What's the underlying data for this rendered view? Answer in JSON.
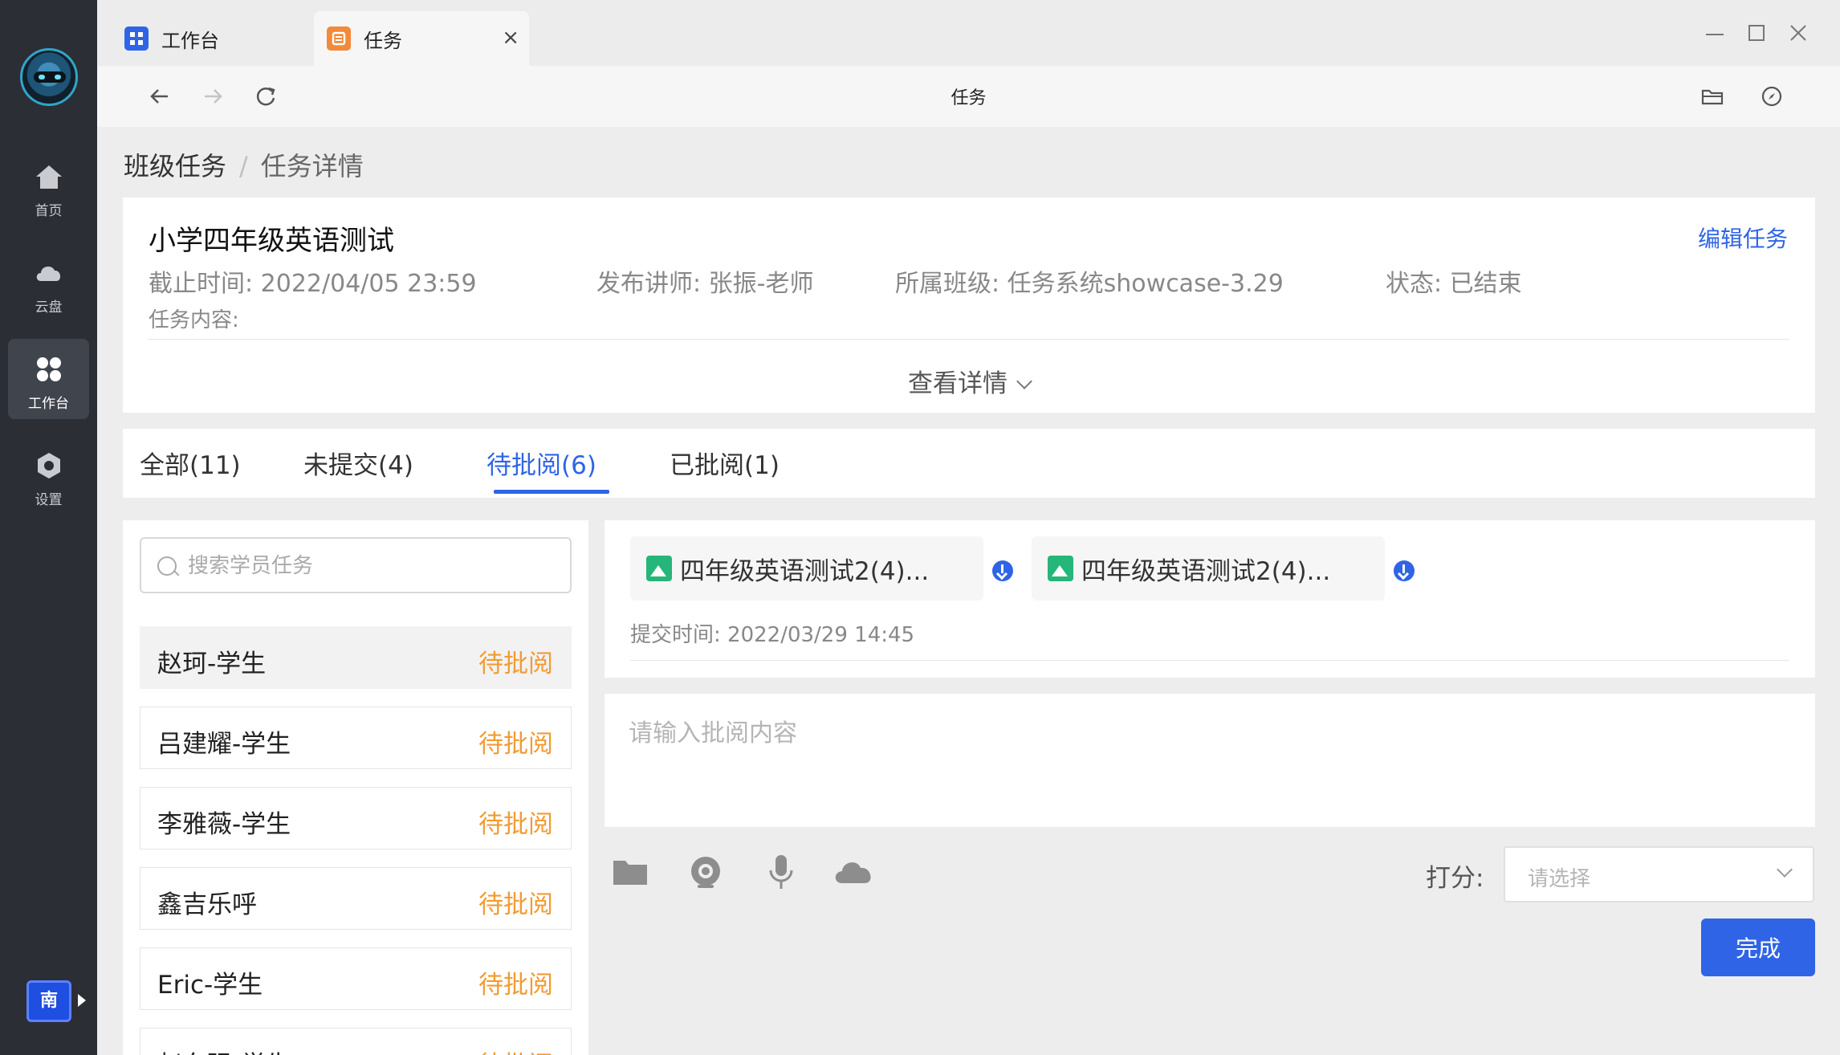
{
  "sidebar": {
    "items": [
      {
        "label": "首页",
        "icon": "home-icon"
      },
      {
        "label": "云盘",
        "icon": "cloud-icon"
      },
      {
        "label": "工作台",
        "icon": "workbench-icon",
        "active": true
      },
      {
        "label": "设置",
        "icon": "settings-icon"
      }
    ],
    "user_badge": "南"
  },
  "window": {
    "tabs": [
      {
        "label": "工作台",
        "icon": "workbench-tab-icon"
      },
      {
        "label": "任务",
        "icon": "task-tab-icon",
        "active": true
      }
    ],
    "close_glyph": "×",
    "address_title": "任务"
  },
  "breadcrumb": {
    "parent": "班级任务",
    "separator": "/",
    "current": "任务详情"
  },
  "task": {
    "title": "小学四年级英语测试",
    "edit_label": "编辑任务",
    "deadline_label": "截止时间:",
    "deadline": "2022/04/05 23:59",
    "teacher_label": "发布讲师:",
    "teacher": "张振-老师",
    "class_label": "所属班级:",
    "class": "任务系统showcase-3.29",
    "status_label": "状态:",
    "status": "已结束",
    "content_label": "任务内容:",
    "view_detail": "查看详情"
  },
  "filter_tabs": [
    {
      "label": "全部(11)"
    },
    {
      "label": "未提交(4)"
    },
    {
      "label": "待批阅(6)",
      "active": true
    },
    {
      "label": "已批阅(1)"
    }
  ],
  "search": {
    "placeholder": "搜索学员任务"
  },
  "students": [
    {
      "name": "赵珂-学生",
      "status": "待批阅",
      "selected": true
    },
    {
      "name": "吕建耀-学生",
      "status": "待批阅"
    },
    {
      "name": "李雅薇-学生",
      "status": "待批阅"
    },
    {
      "name": "鑫吉乐呼",
      "status": "待批阅"
    },
    {
      "name": "Eric-学生",
      "status": "待批阅"
    },
    {
      "name": "赵东强-学生",
      "status": "待批阅"
    }
  ],
  "submission": {
    "files": [
      {
        "name": "四年级英语测试2(4)..."
      },
      {
        "name": "四年级英语测试2(4)..."
      }
    ],
    "time_label": "提交时间:",
    "time": "2022/03/29 14:45"
  },
  "review": {
    "placeholder": "请输入批阅内容",
    "tools": [
      "folder-icon",
      "camera-icon",
      "microphone-icon",
      "cloud-upload-icon"
    ],
    "score_label": "打分:",
    "score_placeholder": "请选择",
    "done_label": "完成"
  },
  "colors": {
    "accent": "#2f64e6",
    "pending": "#f29b33",
    "sidebar_bg": "#2b2e35"
  }
}
